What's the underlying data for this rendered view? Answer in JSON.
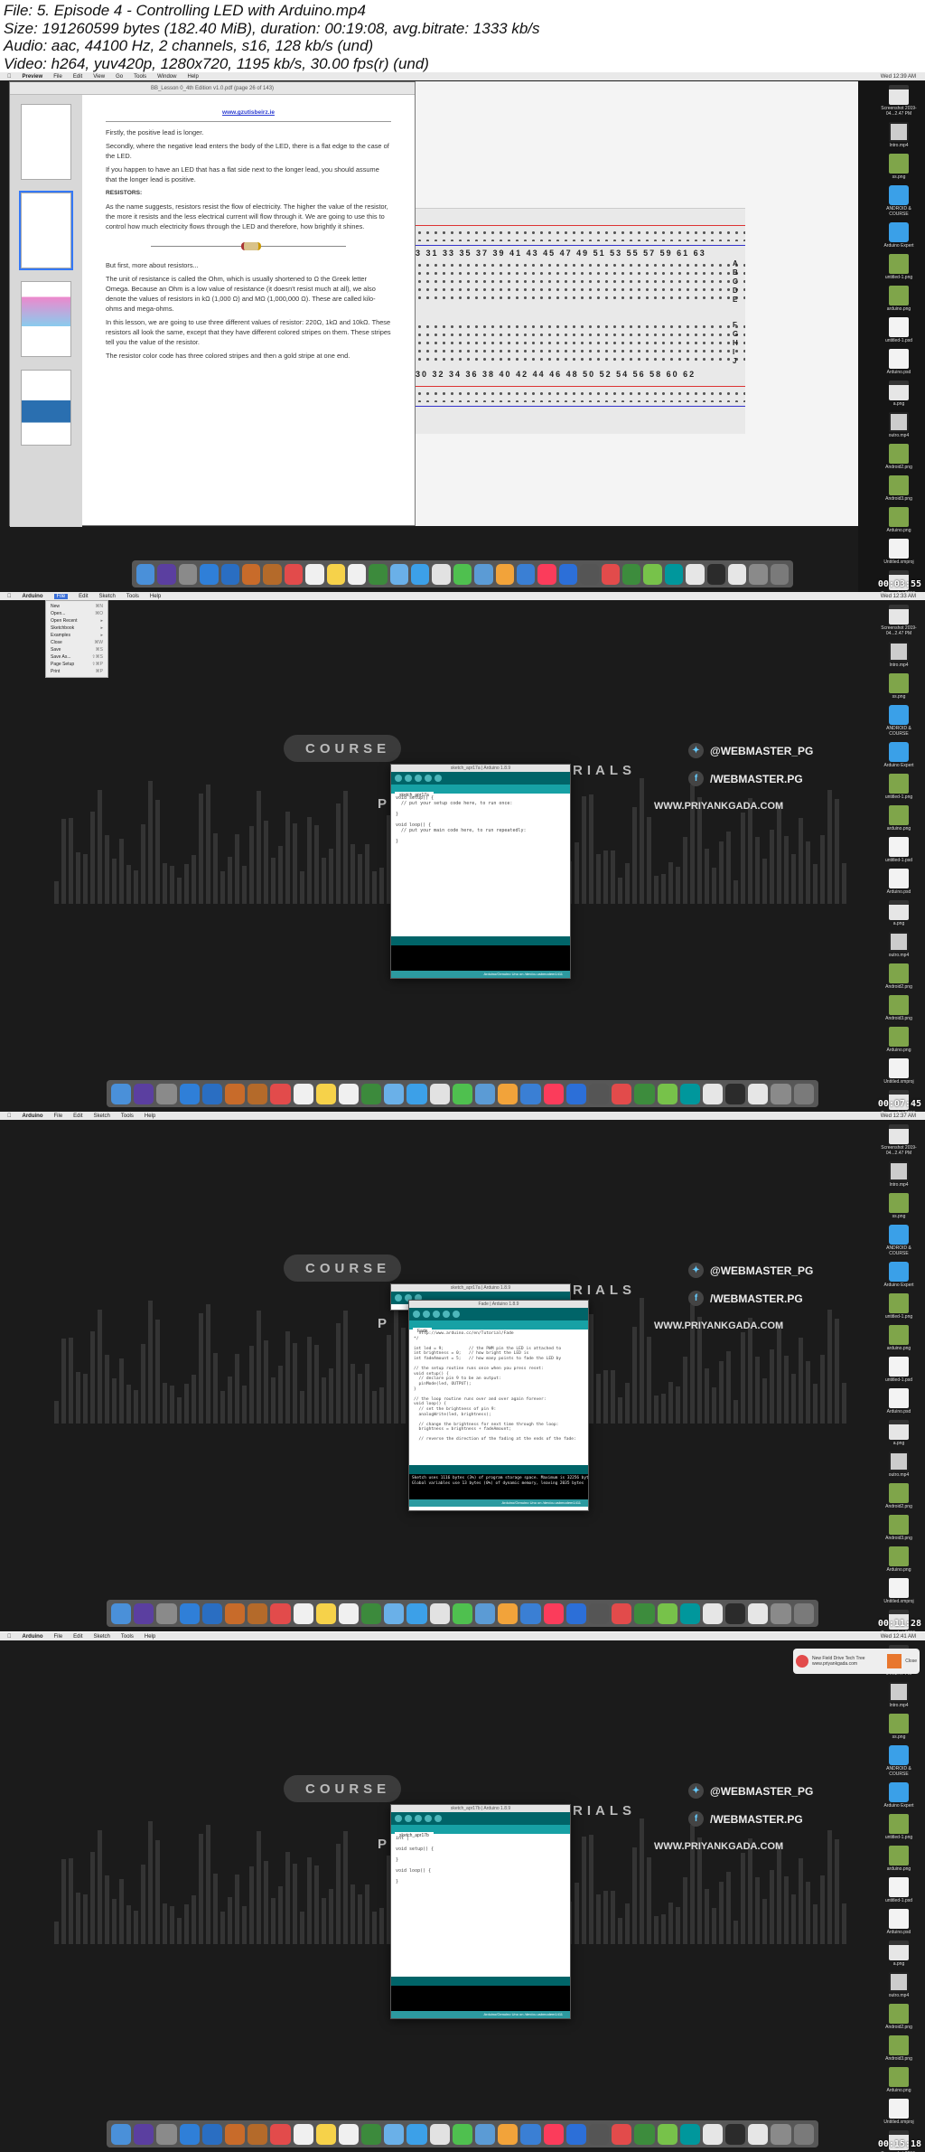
{
  "header": {
    "file": "File: 5. Episode 4 - Controlling LED with Arduino.mp4",
    "size": "Size: 191260599 bytes (182.40 MiB), duration: 00:19:08, avg.bitrate: 1333 kb/s",
    "audio": "Audio: aac, 44100 Hz, 2 channels, s16, 128 kb/s (und)",
    "video": "Video: h264, yuv420p, 1280x720, 1195 kb/s, 30.00 fps(r) (und)"
  },
  "timestamps": [
    "00:03:55",
    "00:07:45",
    "00:11:28",
    "00:15:18"
  ],
  "menus": {
    "preview": [
      "Preview",
      "File",
      "Edit",
      "View",
      "Go",
      "Tools",
      "Window",
      "Help"
    ],
    "arduino": [
      "Arduino",
      "File",
      "Edit",
      "Sketch",
      "Tools",
      "Help"
    ]
  },
  "clocks": [
    "Wed 12:39 AM",
    "Wed 12:33 AM",
    "Wed 12:37 AM",
    "Wed 12:41 AM"
  ],
  "preview_window": {
    "title": "BB_Lesson 0_4th Edition v1.0.pdf (page 26 of 143)",
    "doc_link": "www.gzutisbeirz.ie",
    "paragraphs": [
      "Firstly, the positive lead is longer.",
      "Secondly, where the negative lead enters the body of the LED, there is a flat edge to the case of the LED.",
      "If you happen to have an LED that has a flat side next to the longer lead, you should assume that the longer lead is positive."
    ],
    "heading": "RESISTORS:",
    "paragraphs2": [
      "As the name suggests, resistors resist the flow of electricity. The higher the value of the resistor, the more it resists and the less electrical current will flow through it. We are going to use this to control how much electricity flows through the LED and therefore, how brightly it shines.",
      "But first, more about resistors...",
      "The unit of resistance is called the Ohm, which is usually shortened to Ω the Greek letter Omega. Because an Ohm is a low value of resistance (it doesn't resist much at all), we also denote the values of resistors in kΩ (1,000 Ω) and MΩ (1,000,000 Ω). These are called kilo-ohms and mega-ohms.",
      "In this lesson, we are going to use three different values of resistor: 220Ω, 1kΩ and 10kΩ. These resistors all look the same, except that they have different colored stripes on them. These stripes tell you the value of the resistor.",
      "The resistor color code has three colored stripes and then a gold stripe at one end."
    ],
    "thumb_label": "26"
  },
  "breadboard": {
    "top_numbers": "3  31  33  35  37  39  41  43  45  47  49  51  53  55  57  59  61  63",
    "bottom_numbers": "30  32  34  36  38  40  42  44  46  48  50  52  54  56  58  60  62",
    "letters_top": [
      "A",
      "B",
      "C",
      "D",
      "E"
    ],
    "letters_bottom": [
      "F",
      "G",
      "H",
      "I",
      "J"
    ]
  },
  "branding": {
    "course": "COURSE",
    "tutorials": "RIALS",
    "p": "P",
    "twitter": "@WEBMASTER_PG",
    "facebook": "/WEBMASTER.PG",
    "url": "WWW.PRIYANKGADA.COM"
  },
  "arduino_frame2": {
    "title": "sketch_apr17a | Arduino 1.8.9",
    "tab": "sketch_apr17a",
    "code": "void setup() {\n  // put your setup code here, to run once:\n\n}\n\nvoid loop() {\n  // put your main code here, to run repeatedly:\n\n}",
    "footer": "Arduino/Genuino Uno on /dev/cu.usbmodem1411"
  },
  "file_menu": {
    "items": [
      "New",
      "Open...",
      "Open Recent",
      "Sketchbook",
      "Examples",
      "Close",
      "Save",
      "Save As...",
      "Page Setup",
      "Print"
    ],
    "shortcuts": [
      "⌘N",
      "⌘O",
      "▸",
      "▸",
      "▸",
      "⌘W",
      "⌘S",
      "⇧⌘S",
      "⇧⌘P",
      "⌘P"
    ]
  },
  "arduino_frame3": {
    "title": "Fade | Arduino 1.8.9",
    "tab": "Fade",
    "code": "  http://www.arduino.cc/en/Tutorial/Fade\n*/\n\nint led = 9;          // the PWM pin the LED is attached to\nint brightness = 0;   // how bright the LED is\nint fadeAmount = 5;   // how many points to fade the LED by\n\n// the setup routine runs once when you press reset:\nvoid setup() {\n  // declare pin 9 to be an output:\n  pinMode(led, OUTPUT);\n}\n\n// the loop routine runs over and over again forever:\nvoid loop() {\n  // set the brightness of pin 9:\n  analogWrite(led, brightness);\n\n  // change the brightness for next time through the loop:\n  brightness = brightness + fadeAmount;\n\n  // reverse the direction of the fading at the ends of the fade:",
    "console": "Sketch uses 1116 bytes (3%) of program storage space. Maximum is 32256 bytes.\nGlobal variables use 13 bytes (0%) of dynamic memory, leaving 2035 bytes"
  },
  "arduino_frame4": {
    "title": "sketch_apr17b | Arduino 1.8.9",
    "tab": "sketch_apr17b",
    "code": "int |\n\nvoid setup() {\n\n}\n\nvoid loop() {\n\n}"
  },
  "notification": {
    "text": "New Field Drive Tech Tree www.priyankgada.com",
    "button": "Close"
  },
  "desktop_icons": [
    {
      "label": "Screenshot 2019-04...2.47 PM",
      "kind": "shot"
    },
    {
      "label": "Intro.mp4",
      "kind": "vid"
    },
    {
      "label": "ss.png",
      "kind": "img"
    },
    {
      "label": "ANDROID & COURSE",
      "kind": "folder"
    },
    {
      "label": "Arduino Expert",
      "kind": "folder"
    },
    {
      "label": "untitled-1.png",
      "kind": "img"
    },
    {
      "label": "arduino.png",
      "kind": "img"
    },
    {
      "label": "untitled-1.psd",
      "kind": "doc"
    },
    {
      "label": "Arduino.psd",
      "kind": "doc"
    },
    {
      "label": "a.png",
      "kind": "shot"
    },
    {
      "label": "outro.mp4",
      "kind": "vid"
    },
    {
      "label": "Android2.png",
      "kind": "img"
    },
    {
      "label": "Android3.png",
      "kind": "img"
    },
    {
      "label": "Arduino.png",
      "kind": "img"
    },
    {
      "label": "Untitled.xmproj",
      "kind": "doc"
    },
    {
      "label": "Screenshot 2019-04...2.28 PM",
      "kind": "shot"
    },
    {
      "label": "Screenshot 2019-04...2.37 PM",
      "kind": "shot"
    }
  ],
  "dock_colors": [
    "#4a90d9",
    "#5b3fa0",
    "#8a8a8a",
    "#2f7fd8",
    "#2a6ec2",
    "#c86b2a",
    "#b46a2a",
    "#e24b4b",
    "#f0f0f0",
    "#f6d24a",
    "#f0f0f0",
    "#3c8a3c",
    "#6ab0e8",
    "#3ca0e8",
    "#e2e2e2",
    "#4fc04f",
    "#5b9bd5",
    "#f2a33a",
    "#3a7fd4",
    "#fb3c5b",
    "#2c6fd8",
    "#555555",
    "#e24b4b",
    "#3d8c3d",
    "#77c24a",
    "#00979c",
    "#e6e6e6",
    "#2b2b2b",
    "#e6e6e6",
    "#8a8a8a",
    "#7a7a7a"
  ]
}
